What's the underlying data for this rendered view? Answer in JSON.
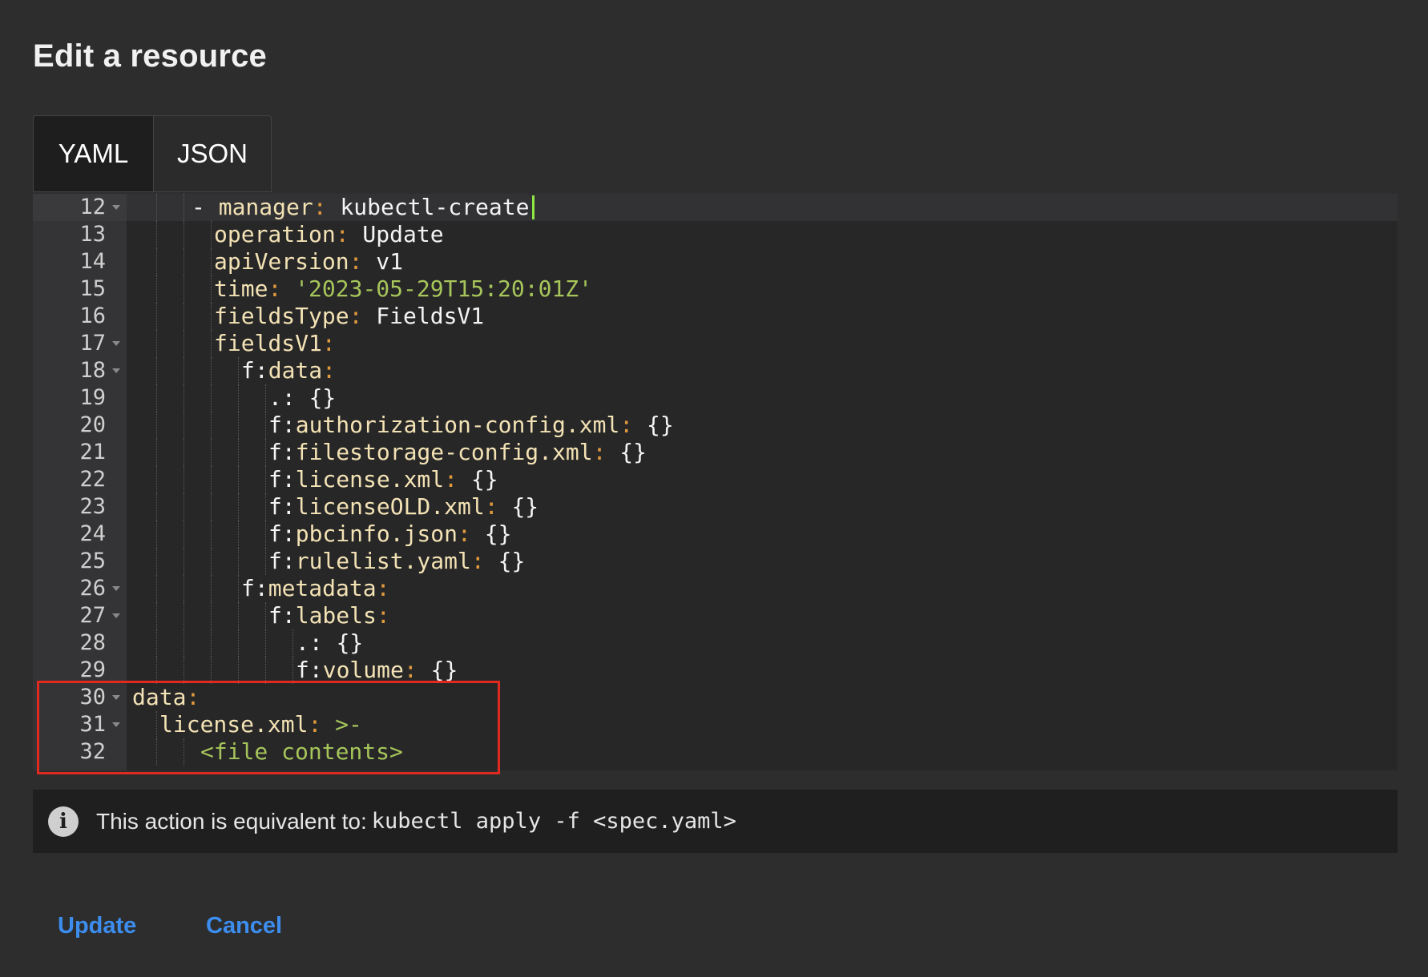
{
  "dialog": {
    "title": "Edit a resource"
  },
  "tabs": [
    {
      "label": "YAML",
      "active": true
    },
    {
      "label": "JSON",
      "active": false
    }
  ],
  "editor": {
    "lines": [
      {
        "num": "12",
        "fold": true,
        "indent": 2,
        "dash": true,
        "key": "manager",
        "value": "kubectl-create",
        "cursor": true,
        "active": true
      },
      {
        "num": "13",
        "indent": 3,
        "key": "operation",
        "value": "Update"
      },
      {
        "num": "14",
        "indent": 3,
        "key": "apiVersion",
        "value": "v1"
      },
      {
        "num": "15",
        "indent": 3,
        "key": "time",
        "string": "'2023-05-29T15:20:01Z'"
      },
      {
        "num": "16",
        "indent": 3,
        "key": "fieldsType",
        "value": "FieldsV1"
      },
      {
        "num": "17",
        "fold": true,
        "indent": 3,
        "key": "fieldsV1"
      },
      {
        "num": "18",
        "fold": true,
        "indent": 4,
        "prefix": "f:",
        "key": "data"
      },
      {
        "num": "19",
        "indent": 5,
        "plain": ".:",
        "value": "{}"
      },
      {
        "num": "20",
        "indent": 5,
        "prefix": "f:",
        "key": "authorization-config.xml",
        "value": "{}"
      },
      {
        "num": "21",
        "indent": 5,
        "prefix": "f:",
        "key": "filestorage-config.xml",
        "value": "{}"
      },
      {
        "num": "22",
        "indent": 5,
        "prefix": "f:",
        "key": "license.xml",
        "value": "{}"
      },
      {
        "num": "23",
        "indent": 5,
        "prefix": "f:",
        "key": "licenseOLD.xml",
        "value": "{}"
      },
      {
        "num": "24",
        "indent": 5,
        "prefix": "f:",
        "key": "pbcinfo.json",
        "value": "{}"
      },
      {
        "num": "25",
        "indent": 5,
        "prefix": "f:",
        "key": "rulelist.yaml",
        "value": "{}"
      },
      {
        "num": "26",
        "fold": true,
        "indent": 4,
        "prefix": "f:",
        "key": "metadata"
      },
      {
        "num": "27",
        "fold": true,
        "indent": 5,
        "prefix": "f:",
        "key": "labels"
      },
      {
        "num": "28",
        "indent": 6,
        "plain": ".:",
        "value": "{}"
      },
      {
        "num": "29",
        "indent": 6,
        "prefix": "f:",
        "key": "volume",
        "value": "{}"
      },
      {
        "num": "30",
        "fold": true,
        "indent": 0,
        "key": "data"
      },
      {
        "num": "31",
        "fold": true,
        "indent": 1,
        "key": "license.xml",
        "string": ">-"
      },
      {
        "num": "32",
        "indent": 2.5,
        "string": "<file contents>"
      }
    ]
  },
  "info": {
    "text": "This action is equivalent to:",
    "command": "kubectl apply -f <spec.yaml>",
    "icon": "info-icon"
  },
  "actions": {
    "update_label": "Update",
    "cancel_label": "Cancel"
  },
  "colors": {
    "accent": "#3c8dee",
    "highlight_border": "#e0291f",
    "cursor": "#8ee645",
    "yaml_key": "#f3e2b4",
    "yaml_punct": "#e09a3c",
    "yaml_string": "#a6c55a"
  }
}
